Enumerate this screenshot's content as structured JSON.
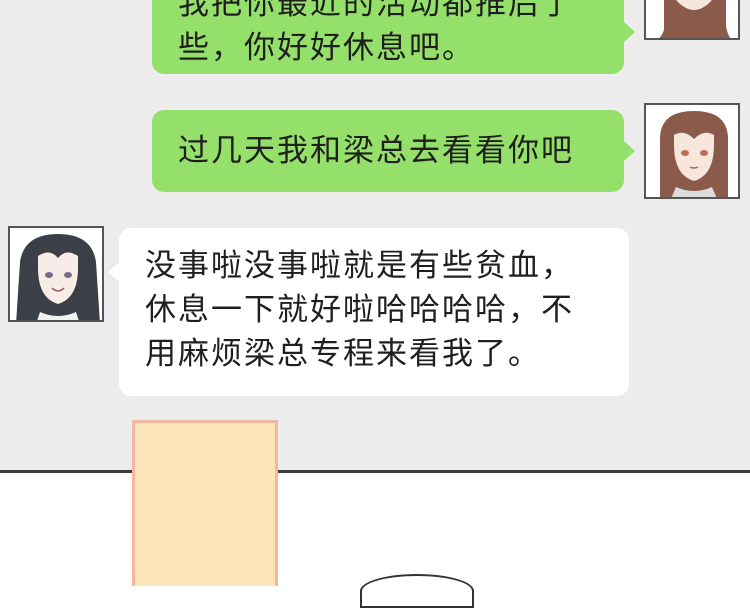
{
  "messages": [
    {
      "side": "right",
      "lines": [
        "我把你最近的活动都推后了",
        "些，你好好休息吧。"
      ]
    },
    {
      "side": "right",
      "lines": [
        "过几天我和梁总去看看你吧"
      ]
    },
    {
      "side": "left",
      "lines": [
        "没事啦没事啦就是有些贫血，",
        "休息一下就好啦哈哈哈哈，不",
        "用麻烦梁总专程来看我了。"
      ]
    }
  ],
  "avatars": {
    "right": "brown-hair-girl-avatar",
    "left": "dark-hair-girl-avatar"
  },
  "colors": {
    "panel_bg": "#ececec",
    "green_bubble": "#95e06a",
    "white_bubble": "#ffffff",
    "sticky_fill": "#fbe4b8",
    "sticky_border": "#f0b8a0"
  }
}
